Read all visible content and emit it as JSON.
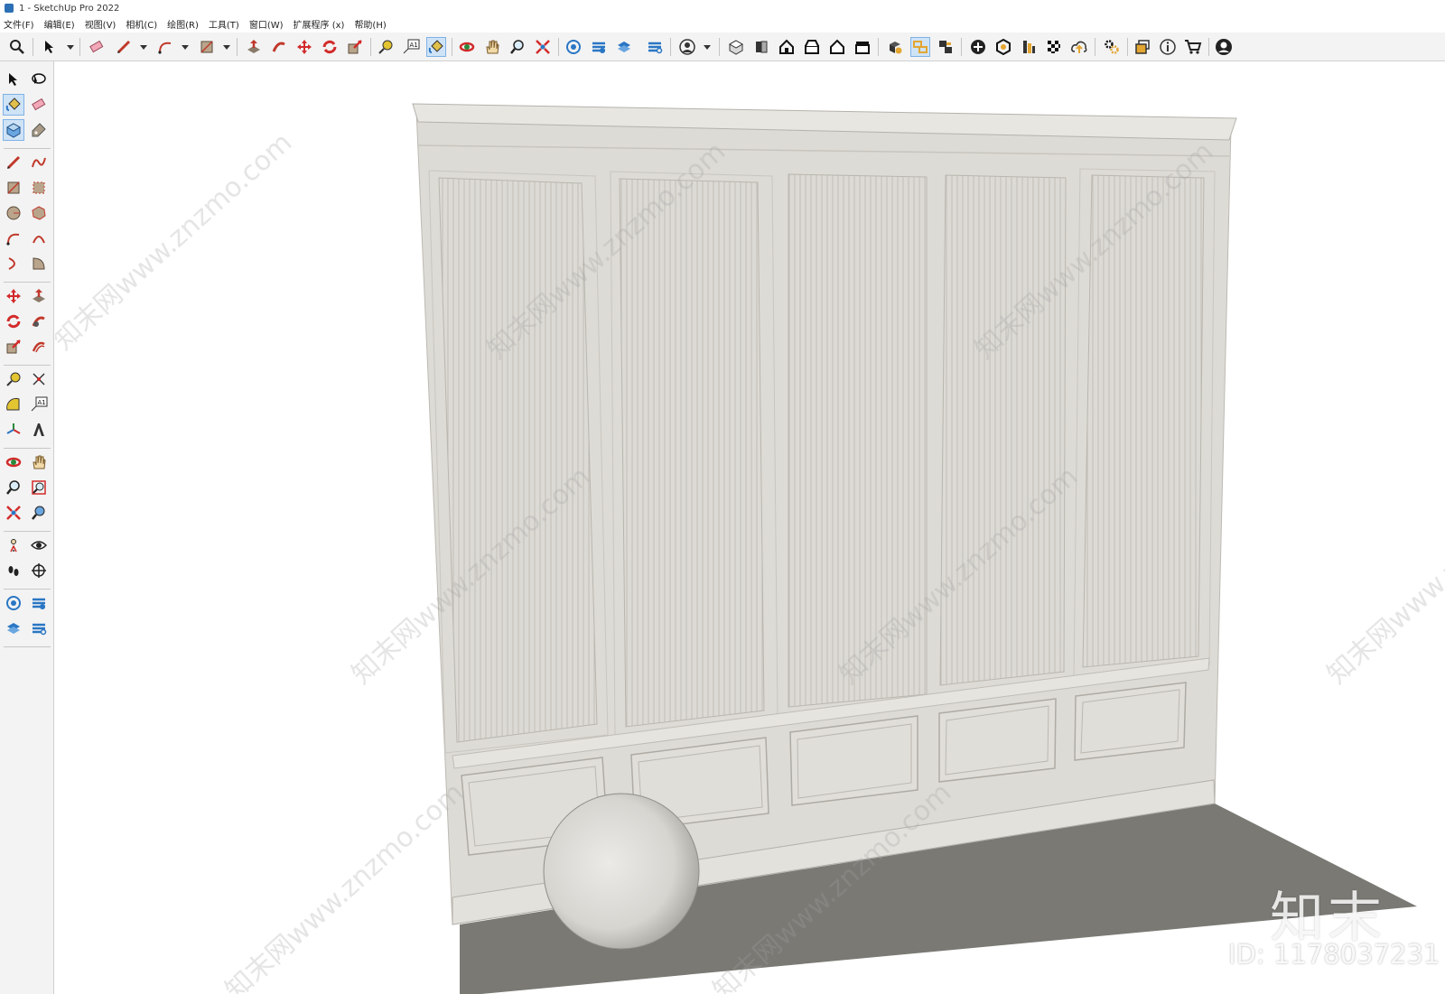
{
  "window": {
    "title": "1 - SketchUp Pro 2022"
  },
  "menu": [
    "文件(F)",
    "编辑(E)",
    "视图(V)",
    "相机(C)",
    "绘图(R)",
    "工具(T)",
    "窗口(W)",
    "扩展程序 (x)",
    "帮助(H)"
  ],
  "toolbar": {
    "text_tool_glyph": "A1"
  },
  "left_toolbar": {
    "text_tool_glyph": "A1"
  },
  "scene": {
    "wall_color": "#dddbd5",
    "floor_color": "#7a7974",
    "sphere_color": "#d9d8d3"
  },
  "watermark": {
    "logo": "知末",
    "id": "ID: 1178037231",
    "diagonal_text": "知末网www.znzmo.com"
  },
  "colors": {
    "accent_active": "#cfe3f7",
    "icon_red": "#d22b2b",
    "icon_blue": "#2a76c4"
  }
}
